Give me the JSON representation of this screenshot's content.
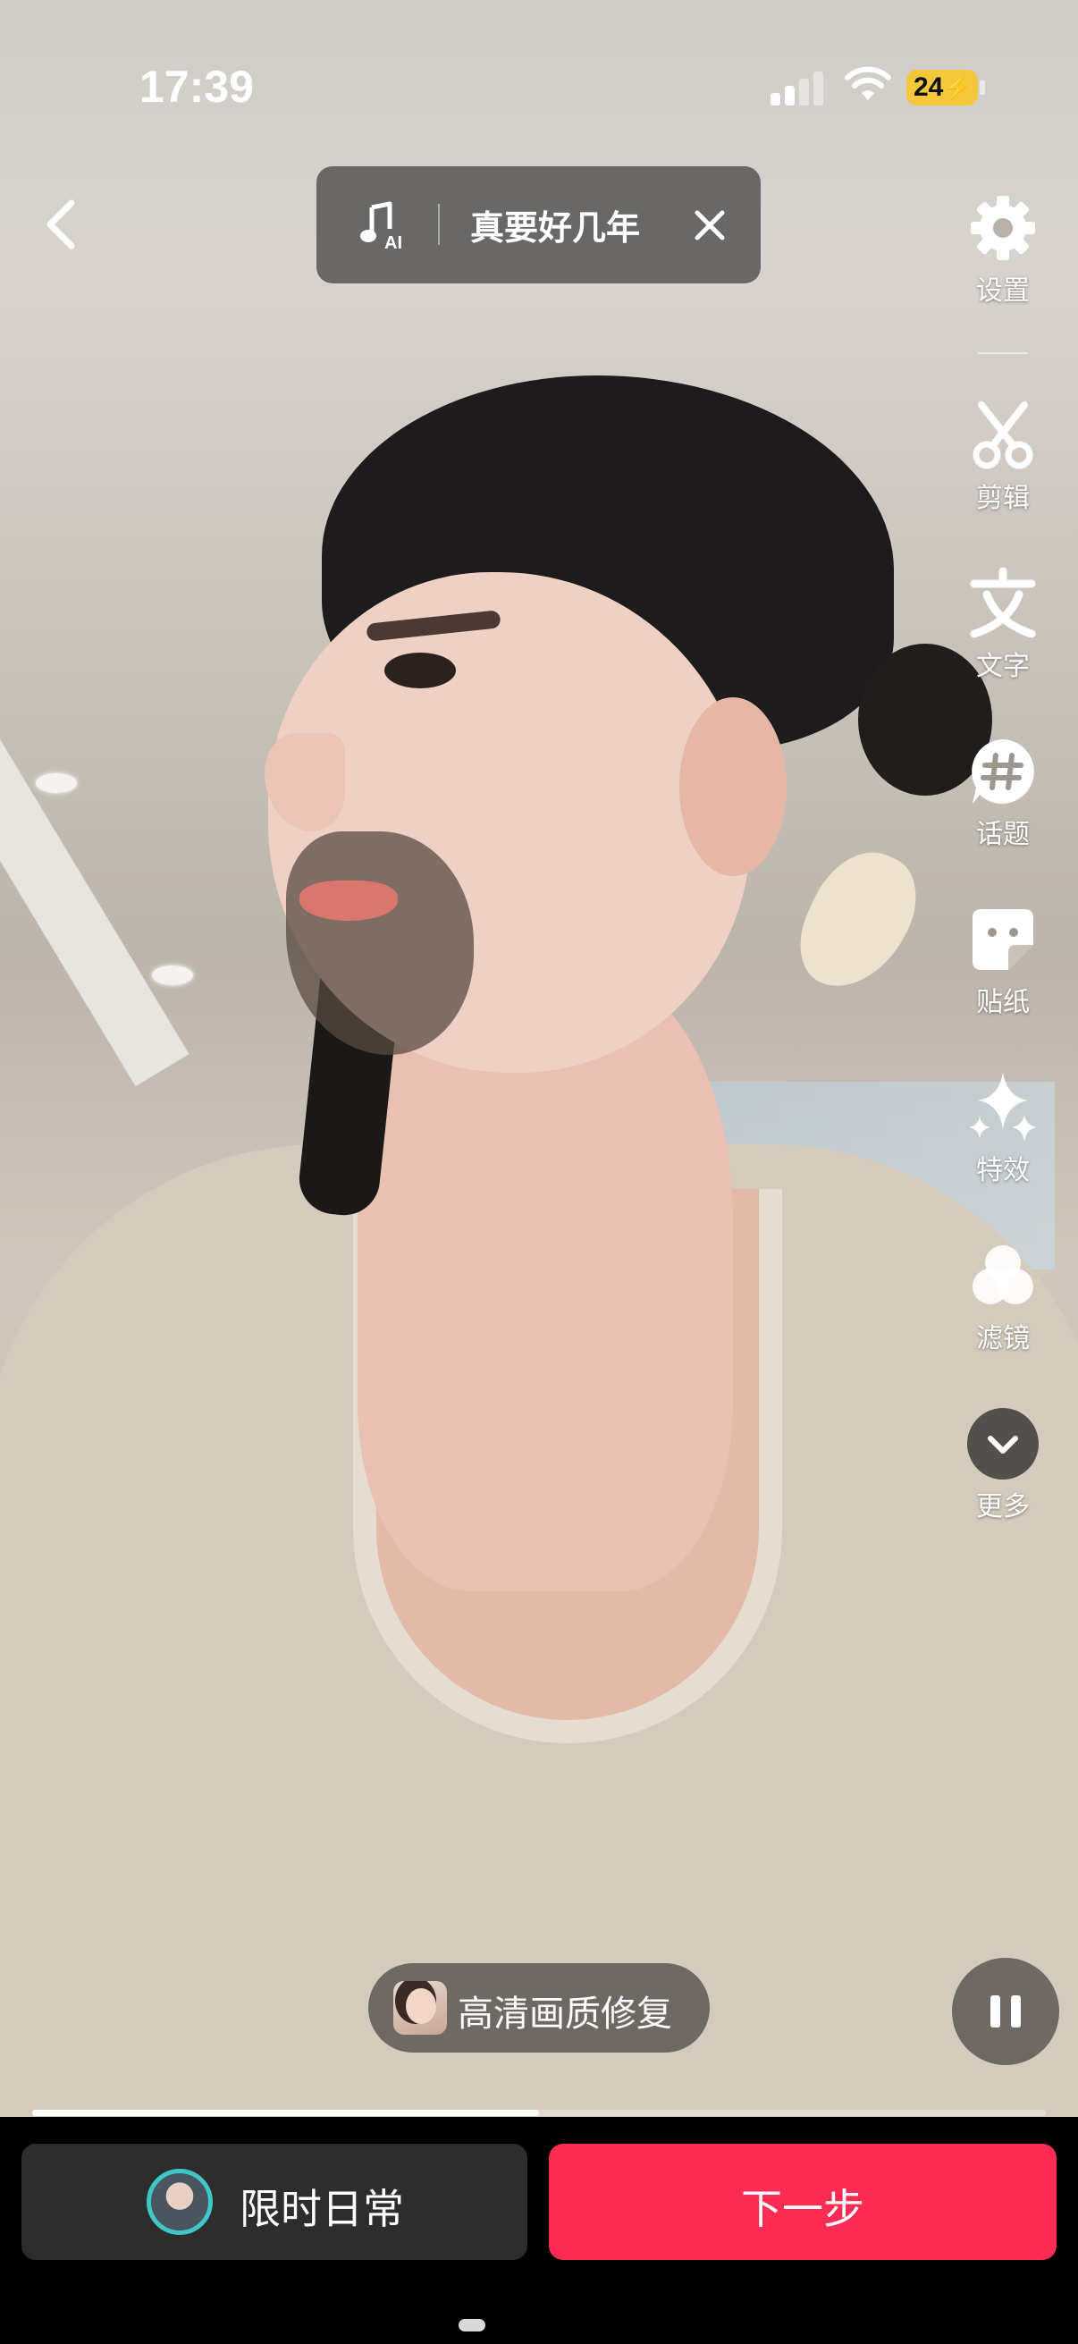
{
  "status_bar": {
    "time": "17:39",
    "battery_level": "24"
  },
  "header": {
    "music_title": "真要好几年"
  },
  "toolbar": {
    "items": [
      {
        "label": "设置",
        "icon": "gear-icon"
      },
      {
        "label": "剪辑",
        "icon": "scissors-icon"
      },
      {
        "label": "文字",
        "icon": "text-icon"
      },
      {
        "label": "话题",
        "icon": "hashtag-icon"
      },
      {
        "label": "贴纸",
        "icon": "sticker-icon"
      },
      {
        "label": "特效",
        "icon": "sparkle-icon"
      },
      {
        "label": "滤镜",
        "icon": "filter-icon"
      },
      {
        "label": "更多",
        "icon": "chevron-down-icon"
      }
    ]
  },
  "preview": {
    "hd_repair_label": "高清画质修复",
    "playback_progress": 0.5
  },
  "bottom": {
    "daily_label": "限时日常",
    "next_label": "下一步"
  },
  "colors": {
    "accent": "#fe2c55",
    "battery": "#f3c83a",
    "avatar_ring": "#3fc7c8"
  }
}
